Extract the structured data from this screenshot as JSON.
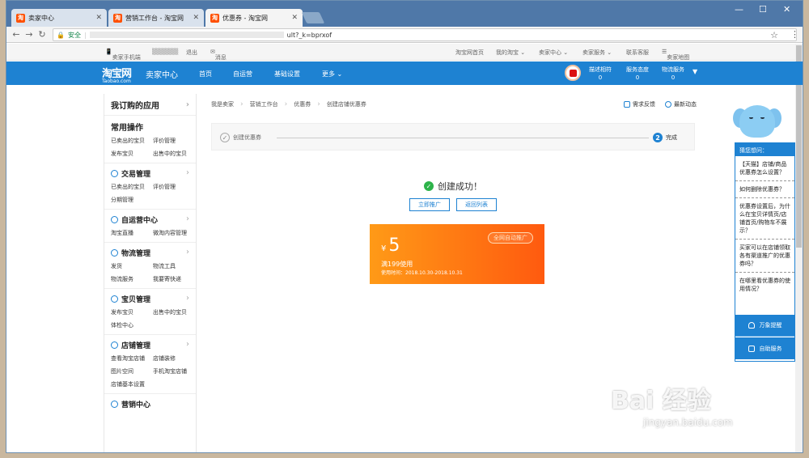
{
  "browser": {
    "tabs": [
      {
        "label": "卖家中心"
      },
      {
        "label": "营销工作台 - 淘宝网"
      },
      {
        "label": "优惠券 - 淘宝网"
      }
    ],
    "favicon_text": "淘",
    "url_secure": "安全",
    "url_text": "ult?_k=bprxof"
  },
  "topbar": {
    "mobile": "卖家手机端",
    "logout": "退出",
    "message": "消息",
    "links": [
      "淘宝网首页",
      "我的淘宝 ⌄",
      "卖家中心 ⌄",
      "卖家服务 ⌄",
      "联系客服",
      "卖家地图"
    ]
  },
  "header": {
    "logo": "淘宝网",
    "logo_sub": "Taobao.com",
    "site": "卖家中心",
    "nav": [
      "首页",
      "自运营",
      "基础设置",
      "更多 ⌄"
    ],
    "metrics": [
      {
        "label": "描述相符",
        "value": "0"
      },
      {
        "label": "服务态度",
        "value": "0"
      },
      {
        "label": "物流服务",
        "value": "0"
      }
    ]
  },
  "sidebar": {
    "apps": "我订购的应用",
    "common": {
      "title": "常用操作",
      "links": [
        "已卖出的宝贝",
        "评价管理",
        "发布宝贝",
        "出售中的宝贝"
      ]
    },
    "sections": [
      {
        "title": "交易管理",
        "links": [
          "已卖出的宝贝",
          "评价管理",
          "分期管理"
        ]
      },
      {
        "title": "自运营中心",
        "links": [
          "淘宝直播",
          "微淘内容管理"
        ]
      },
      {
        "title": "物流管理",
        "links": [
          "发货",
          "物流工具",
          "物流服务",
          "我要寄快递"
        ]
      },
      {
        "title": "宝贝管理",
        "links": [
          "发布宝贝",
          "出售中的宝贝",
          "体检中心"
        ]
      },
      {
        "title": "店铺管理",
        "links": [
          "查看淘宝店铺",
          "店铺装修",
          "图片空间",
          "手机淘宝店铺",
          "店铺基本设置"
        ]
      },
      {
        "title": "营销中心",
        "links": []
      }
    ]
  },
  "main": {
    "breadcrumb": [
      "我是卖家",
      "营销工作台",
      "优惠券",
      "创建店铺优惠券"
    ],
    "feedback": "需求反馈",
    "news": "最新动态",
    "step1": "创建优惠券",
    "step2_num": "2",
    "step2": "完成",
    "success": "创建成功！",
    "btn_promote": "立即推广",
    "btn_list": "返回列表",
    "coupon": {
      "currency": "¥",
      "amount": "5",
      "tag": "全网自动推广",
      "condition": "满199使用",
      "date": "使用时间：2018.10.30-2018.10.31"
    }
  },
  "help": {
    "title": "猜您想问：",
    "questions": [
      "【天猫】店铺/商品优惠券怎么设置？",
      "如何删除优惠券？",
      "优惠券设置后，为什么在宝贝详情页/店铺首页/购物车不展示？",
      "买家可以在店铺领取各有渠道推广的优惠券吗？",
      "在哪里看优惠券的使用情况？"
    ],
    "btn1": "万象提醒",
    "btn2": "自助服务"
  },
  "watermark": {
    "main": "Bai 经验",
    "sub": "jingyan.baidu.com"
  }
}
